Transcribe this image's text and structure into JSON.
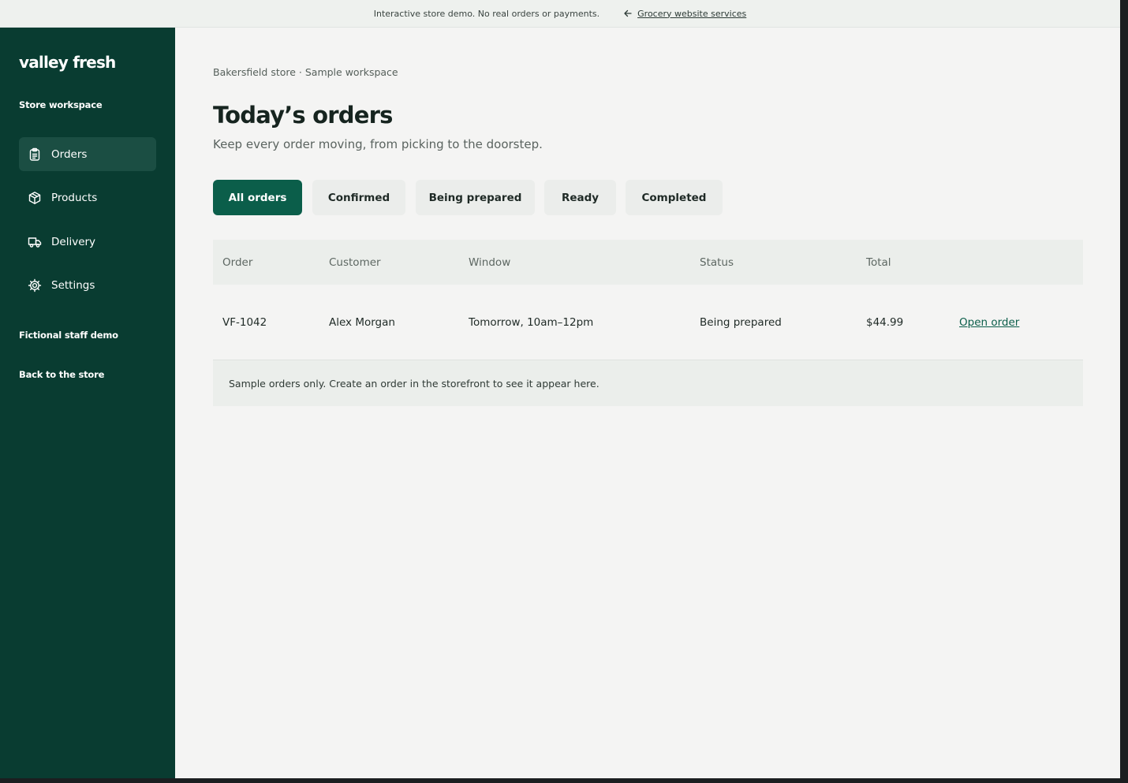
{
  "topbar": {
    "notice": "Interactive store demo. No real orders or payments.",
    "back_link": "Grocery website services"
  },
  "sidebar": {
    "logo": "valley fresh",
    "workspace_label": "Store workspace",
    "items": [
      {
        "label": "Orders",
        "icon": "clipboard-icon",
        "active": true
      },
      {
        "label": "Products",
        "icon": "box-icon",
        "active": false
      },
      {
        "label": "Delivery",
        "icon": "truck-icon",
        "active": false
      },
      {
        "label": "Settings",
        "icon": "gear-icon",
        "active": false
      }
    ],
    "demo_label": "Fictional staff demo",
    "back_label": "Back to the store"
  },
  "main": {
    "breadcrumb": "Bakersfield store · Sample workspace",
    "title": "Today’s orders",
    "subtitle": "Keep every order moving, from picking to the doorstep.",
    "filters": [
      {
        "label": "All orders",
        "active": true
      },
      {
        "label": "Confirmed",
        "active": false
      },
      {
        "label": "Being prepared",
        "active": false
      },
      {
        "label": "Ready",
        "active": false
      },
      {
        "label": "Completed",
        "active": false
      }
    ],
    "table": {
      "columns": [
        "Order",
        "Customer",
        "Window",
        "Status",
        "Total"
      ],
      "rows": [
        {
          "order": "VF-1042",
          "customer": "Alex Morgan",
          "window": "Tomorrow, 10am–12pm",
          "status": "Being prepared",
          "total": "$44.99",
          "action": "Open order"
        }
      ],
      "note": "Sample orders only. Create an order in the storefront to see it appear here."
    }
  },
  "colors": {
    "sidebar": "#093c31",
    "accent": "#0b5e4a",
    "page_bg": "#f4f4f3"
  }
}
